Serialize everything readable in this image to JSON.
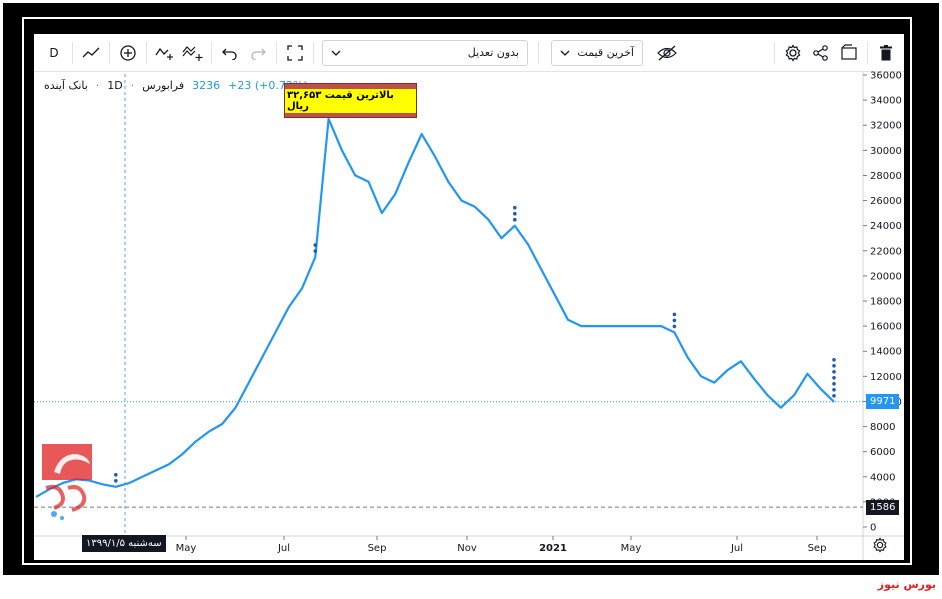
{
  "toolbar": {
    "interval": "D",
    "adjustment_select": "بدون تعدیل",
    "price_type_select": "آخرین قیمت"
  },
  "legend": {
    "symbol": "بانک آینده",
    "interval": "1D",
    "exchange": "فرابورس",
    "price": "3236",
    "change": "+23 (+0.72%)"
  },
  "annotation": {
    "text": "بالاترین قیمت ۳۲,۶۵۳ ریال"
  },
  "crosshair": {
    "date_label": "سه‌شنبه ۱۳۹۹/۱/۵"
  },
  "price_labels": {
    "last": "9971",
    "ref": "1586"
  },
  "colors": {
    "line": "#2196f3",
    "annotation_bg": "#c0504d",
    "annotation_text_bg": "#ffff00",
    "brand": "#e02020"
  },
  "brand": "بورس نیوز",
  "chart_data": {
    "type": "line",
    "title": "",
    "xlabel": "",
    "ylabel": "",
    "ylim": [
      0,
      36000
    ],
    "x_ticks": [
      "May",
      "Jul",
      "Sep",
      "Nov",
      "2021",
      "May",
      "Jul",
      "Sep"
    ],
    "y_ticks": [
      0,
      2000,
      4000,
      6000,
      8000,
      10000,
      12000,
      14000,
      16000,
      18000,
      20000,
      22000,
      24000,
      26000,
      28000,
      30000,
      32000,
      34000,
      36000
    ],
    "grid": false,
    "series": [
      {
        "values": [
          2400,
          3000,
          3500,
          3800,
          3700,
          3400,
          3200,
          3500,
          4000,
          4500,
          5000,
          5800,
          6800,
          7600,
          8200,
          9500,
          11500,
          13500,
          15500,
          17500,
          19000,
          21500,
          32500,
          30000,
          28000,
          27500,
          25000,
          26500,
          29000,
          31300,
          29500,
          27500,
          26000,
          25500,
          24500,
          23000,
          24000,
          22500,
          20500,
          18500,
          16500,
          16000,
          16000,
          16000,
          16000,
          16000,
          16000,
          16000,
          15500,
          13500,
          12000,
          11500,
          12500,
          13200,
          11800,
          10500,
          9500,
          10500,
          12200,
          11000,
          9971
        ]
      }
    ],
    "reference_lines": [
      9971,
      1586
    ]
  }
}
